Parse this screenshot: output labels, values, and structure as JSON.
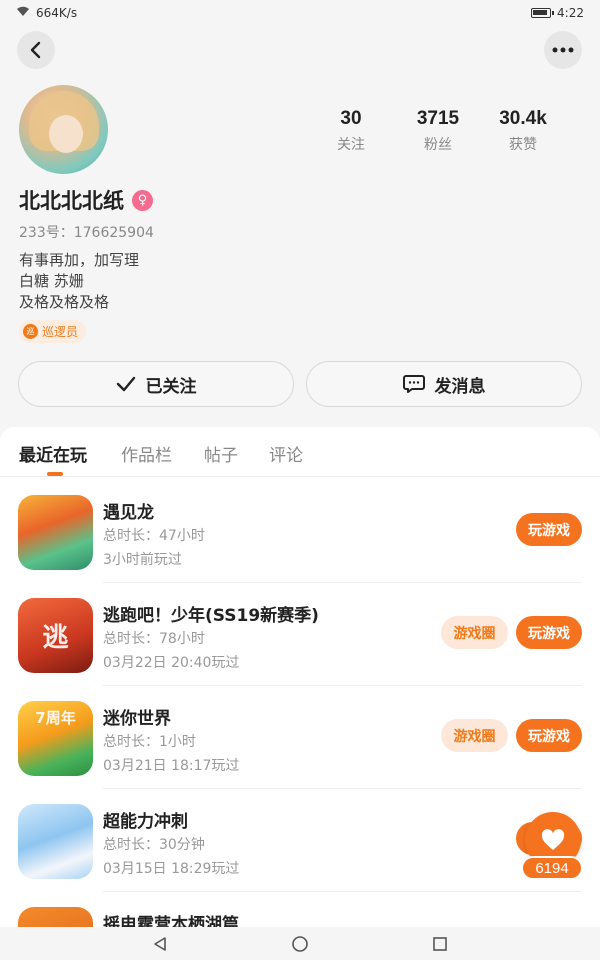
{
  "status_bar": {
    "net_speed": "664K/s",
    "time": "4:22"
  },
  "profile": {
    "username": "北北北北纸",
    "uid_text": "233号：176625904",
    "bio": [
      "有事再加，加写理",
      "白糖  苏姗",
      "及格及格及格"
    ],
    "role_tag": "巡逻员",
    "role_icon_text": "巡",
    "gender_icon": "female-icon"
  },
  "stats": [
    {
      "value": "30",
      "label": "关注"
    },
    {
      "value": "3715",
      "label": "粉丝"
    },
    {
      "value": "30.4k",
      "label": "获赞"
    }
  ],
  "actions": {
    "follow_label": "已关注",
    "message_label": "发消息"
  },
  "tabs": [
    {
      "label": "最近在玩",
      "active": true
    },
    {
      "label": "作品栏",
      "active": false
    },
    {
      "label": "帖子",
      "active": false
    },
    {
      "label": "评论",
      "active": false
    }
  ],
  "games": [
    {
      "title": "遇见龙",
      "duration": "总时长：47小时",
      "last_played": "3小时前玩过",
      "play_label": "玩游戏",
      "circle_label": "",
      "icon": "dragon-game-icon"
    },
    {
      "title": "逃跑吧！少年(SS19新赛季)",
      "duration": "总时长：78小时",
      "last_played": "03月22日 20:40玩过",
      "play_label": "玩游戏",
      "circle_label": "游戏圈",
      "icon": "escape-game-icon",
      "icon_text": "逃"
    },
    {
      "title": "迷你世界",
      "duration": "总时长：1小时",
      "last_played": "03月21日 18:17玩过",
      "play_label": "玩游戏",
      "circle_label": "游戏圈",
      "icon": "mini-world-game-icon",
      "icon_text": "7周年"
    },
    {
      "title": "超能力冲刺",
      "duration": "总时长：30分钟",
      "last_played": "03月15日 18:29玩过",
      "play_label": "玩游戏",
      "circle_label": "",
      "icon": "super-sprint-game-icon"
    },
    {
      "title": "摇电霆营本栖湖篇",
      "duration": "",
      "last_played": "",
      "play_label": "",
      "circle_label": "",
      "icon": "shake-game-icon"
    }
  ],
  "like_fab": {
    "count": "6194",
    "icon": "heart-icon"
  },
  "colors": {
    "accent": "#f5731f",
    "accent_light": "#fde7d8",
    "gender": "#f46b8f"
  }
}
